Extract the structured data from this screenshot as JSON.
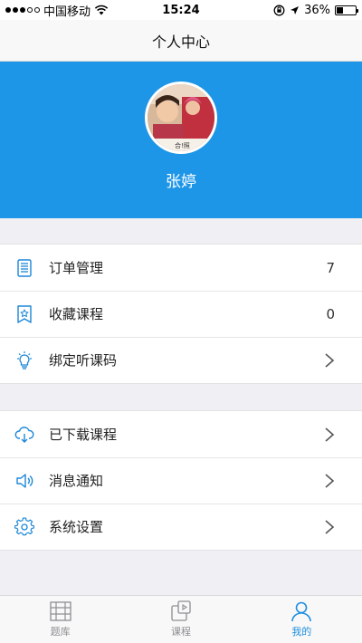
{
  "status_bar": {
    "carrier": "中国移动",
    "time": "15:24",
    "battery": "36%",
    "battery_level": 0.36
  },
  "nav": {
    "title": "个人中心"
  },
  "profile": {
    "name": "张婷",
    "avatar_caption": "合!照"
  },
  "group1": [
    {
      "label": "订单管理",
      "value": "7",
      "icon": "order-list-icon"
    },
    {
      "label": "收藏课程",
      "value": "0",
      "icon": "favorite-bookmark-icon"
    },
    {
      "label": "绑定听课码",
      "value": "",
      "icon": "lightbulb-icon"
    }
  ],
  "group2": [
    {
      "label": "已下载课程",
      "icon": "cloud-download-icon"
    },
    {
      "label": "消息通知",
      "icon": "speaker-icon"
    },
    {
      "label": "系统设置",
      "icon": "gear-icon"
    }
  ],
  "tabs": [
    {
      "label": "题库",
      "icon": "question-bank-icon",
      "active": false
    },
    {
      "label": "课程",
      "icon": "course-icon",
      "active": false
    },
    {
      "label": "我的",
      "icon": "person-icon",
      "active": true
    }
  ],
  "colors": {
    "brand_blue": "#1e96e8",
    "active_tab": "#1e8fe0",
    "icon_blue": "#1b87d8",
    "background": "#efeff4"
  }
}
